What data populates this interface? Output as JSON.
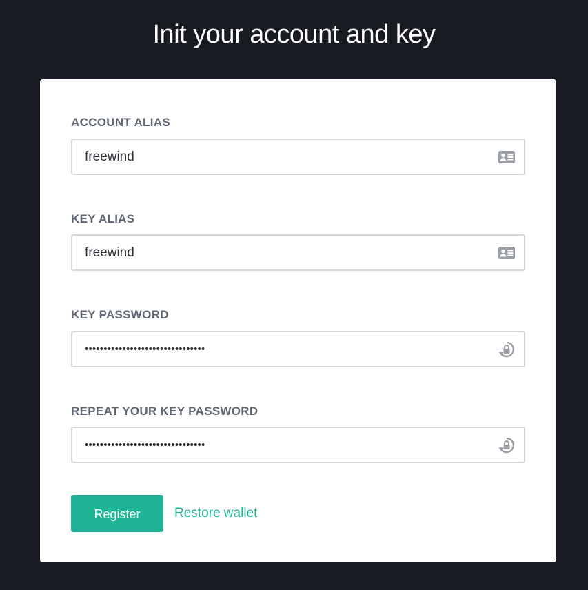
{
  "page": {
    "title": "Init your account and key"
  },
  "form": {
    "account_alias": {
      "label": "ACCOUNT ALIAS",
      "value": "freewind",
      "icon": "id-card-icon"
    },
    "key_alias": {
      "label": "KEY ALIAS",
      "value": "freewind",
      "icon": "id-card-icon"
    },
    "key_password": {
      "label": "KEY PASSWORD",
      "value": "••••••••••••••••••••••••••••••••",
      "icon": "lock-reset-icon"
    },
    "repeat_key_password": {
      "label": "REPEAT YOUR KEY PASSWORD",
      "value": "••••••••••••••••••••••••••••••••",
      "icon": "lock-reset-icon"
    }
  },
  "actions": {
    "register_label": "Register",
    "restore_label": "Restore wallet"
  },
  "colors": {
    "background": "#181b22",
    "card": "#ffffff",
    "accent": "#1db394",
    "label": "#5f6773",
    "input_border": "#d5d7db",
    "icon": "#9a9ea5"
  }
}
